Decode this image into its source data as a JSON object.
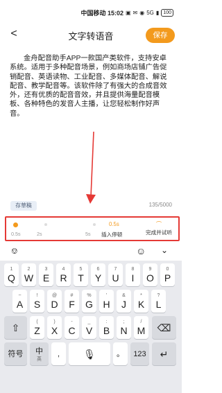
{
  "status_bar": {
    "carrier_time": "中国移动 15:02",
    "icons": [
      "sim-icon",
      "message-icon",
      "wifi-icon",
      "signal-icon"
    ],
    "network": "5G",
    "battery": "100"
  },
  "nav": {
    "title": "文字转语音",
    "save_label": "保存"
  },
  "editor": {
    "text": "金舟配音助手APP一款国产类软件，支持安卓系统。适用于多种配音场景，例如商场店铺广告促销配音、英语读物、工业配音、多媒体配音、解说配音、教学配音等。该软件除了有强大的合成音效外，还有优质的配音音效，并且提供海量配音模板、各种特色的发音人主播，让您轻松制作好声音。",
    "draft_label": "存草稿",
    "counter": "135/5000"
  },
  "toolbar": {
    "tick_0": "0.5s",
    "tick_1": "2s",
    "tick_2": "5s",
    "current_value": "0.5s",
    "insert_label": "插入停顿",
    "finish_label": "完成并试听",
    "accent": "#f39a1d",
    "highlight_border": "#e53935"
  },
  "keyboard": {
    "row1": [
      {
        "main": "Q",
        "sub": "1"
      },
      {
        "main": "W",
        "sub": "2"
      },
      {
        "main": "E",
        "sub": "3"
      },
      {
        "main": "R",
        "sub": "4"
      },
      {
        "main": "T",
        "sub": "5"
      },
      {
        "main": "Y",
        "sub": "6"
      },
      {
        "main": "U",
        "sub": "7"
      },
      {
        "main": "I",
        "sub": "8"
      },
      {
        "main": "O",
        "sub": "9"
      },
      {
        "main": "P",
        "sub": "0"
      }
    ],
    "row2": [
      {
        "main": "A",
        "sub": "~"
      },
      {
        "main": "S",
        "sub": "!"
      },
      {
        "main": "D",
        "sub": "@"
      },
      {
        "main": "F",
        "sub": "#"
      },
      {
        "main": "G",
        "sub": "%"
      },
      {
        "main": "H",
        "sub": "'"
      },
      {
        "main": "J",
        "sub": "&"
      },
      {
        "main": "K",
        "sub": "*"
      },
      {
        "main": "L",
        "sub": "?"
      }
    ],
    "row3": [
      {
        "main": "Z",
        "sub": "("
      },
      {
        "main": "X",
        "sub": ")"
      },
      {
        "main": "C",
        "sub": "-"
      },
      {
        "main": "V",
        "sub": "_"
      },
      {
        "main": "B",
        "sub": ":"
      },
      {
        "main": "N",
        "sub": ";"
      },
      {
        "main": "M",
        "sub": "/"
      }
    ],
    "symbol_label": "符号",
    "lang_label": "中",
    "lang_sub": "英",
    "comma_label": ",",
    "period_label": "。",
    "num_label": "123"
  }
}
